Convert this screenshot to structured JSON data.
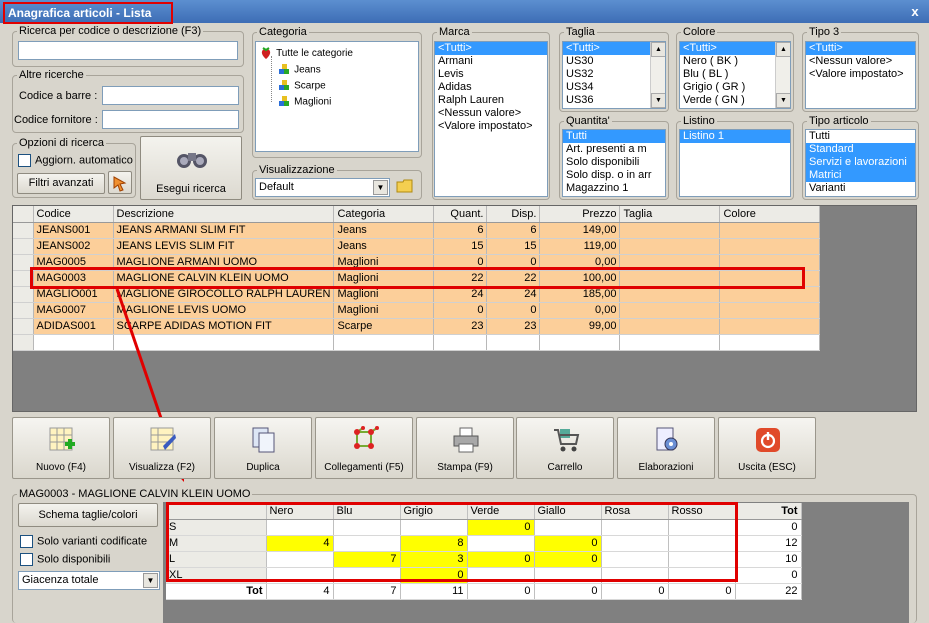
{
  "window": {
    "title": "Anagrafica articoli  - Lista",
    "close": "x"
  },
  "search": {
    "label": "Ricerca per codice o descrizione (F3)",
    "value": ""
  },
  "altre": {
    "label": "Altre ricerche",
    "barcode_label": "Codice a barre :",
    "barcode_value": "",
    "supplier_label": "Codice fornitore :",
    "supplier_value": ""
  },
  "opzioni": {
    "label": "Opzioni di ricerca",
    "auto_update": "Aggiorn. automatico",
    "advanced": "Filtri avanzati"
  },
  "execute": "Esegui ricerca",
  "categoria": {
    "label": "Categoria",
    "root": "Tutte le categorie",
    "children": [
      "Jeans",
      "Scarpe",
      "Maglioni"
    ]
  },
  "visualizzazione": {
    "label": "Visualizzazione",
    "value": "Default"
  },
  "marca": {
    "label": "Marca",
    "items": [
      "<Tutti>",
      "Armani",
      "Levis",
      "Adidas",
      "Ralph Lauren",
      "<Nessun valore>",
      "<Valore impostato>"
    ]
  },
  "taglia": {
    "label": "Taglia",
    "items": [
      "<Tutti>",
      "US30",
      "US32",
      "US34",
      "US36"
    ]
  },
  "colore": {
    "label": "Colore",
    "items": [
      "<Tutti>",
      "Nero ( BK )",
      "Blu ( BL )",
      "Grigio ( GR )",
      "Verde ( GN )"
    ]
  },
  "tipo3": {
    "label": "Tipo 3",
    "items": [
      "<Tutti>",
      "<Nessun valore>",
      "<Valore impostato>"
    ]
  },
  "quantita": {
    "label": "Quantita'",
    "items": [
      "Tutti",
      "Art. presenti a m",
      "Solo disponibili",
      "Solo disp. o in arr",
      "Magazzino 1"
    ]
  },
  "listino": {
    "label": "Listino",
    "items": [
      "Listino 1"
    ]
  },
  "tipo_articolo": {
    "label": "Tipo articolo",
    "items": [
      "Tutti",
      "Standard",
      "Servizi e lavorazioni",
      "Matrici",
      "Varianti"
    ]
  },
  "grid": {
    "columns": [
      "Codice",
      "Descrizione",
      "Categoria",
      "Quant.",
      "Disp.",
      "Prezzo",
      "Taglia",
      "Colore"
    ],
    "rows": [
      [
        "JEANS001",
        "JEANS ARMANI SLIM FIT",
        "Jeans",
        "6",
        "6",
        "149,00",
        "",
        ""
      ],
      [
        "JEANS002",
        "JEANS LEVIS SLIM  FIT",
        "Jeans",
        "15",
        "15",
        "119,00",
        "",
        ""
      ],
      [
        "MAG0005",
        "MAGLIONE ARMANI UOMO",
        "Maglioni",
        "0",
        "0",
        "0,00",
        "",
        ""
      ],
      [
        "MAG0003",
        "MAGLIONE CALVIN KLEIN UOMO",
        "Maglioni",
        "22",
        "22",
        "100,00",
        "",
        ""
      ],
      [
        "MAGLIO001",
        "MAGLIONE GIROCOLLO RALPH LAUREN",
        "Maglioni",
        "24",
        "24",
        "185,00",
        "",
        ""
      ],
      [
        "MAG0007",
        "MAGLIONE LEVIS UOMO",
        "Maglioni",
        "0",
        "0",
        "0,00",
        "",
        ""
      ],
      [
        "ADIDAS001",
        "SCARPE ADIDAS MOTION FIT",
        "Scarpe",
        "23",
        "23",
        "99,00",
        "",
        ""
      ]
    ]
  },
  "toolbar": [
    "Nuovo (F4)",
    "Visualizza (F2)",
    "Duplica",
    "Collegamenti (F5)",
    "Stampa (F9)",
    "Carrello",
    "Elaborazioni",
    "Uscita (ESC)"
  ],
  "detail": {
    "title": "MAG0003 - MAGLIONE CALVIN KLEIN UOMO",
    "scheme_button": "Schema taglie/colori",
    "only_coded": "Solo varianti codificate",
    "only_available": "Solo disponibili",
    "giacenza": "Giacenza totale",
    "colors": [
      "Nero",
      "Blu",
      "Grigio",
      "Verde",
      "Giallo",
      "Rosa",
      "Rosso"
    ],
    "tot_label": "Tot",
    "sizes": [
      {
        "size": "S",
        "cells": [
          "",
          "",
          "",
          "0",
          "",
          "",
          ""
        ],
        "tot": "0"
      },
      {
        "size": "M",
        "cells": [
          "4",
          "",
          "8",
          "",
          "0",
          "",
          ""
        ],
        "tot": "12"
      },
      {
        "size": "L",
        "cells": [
          "",
          "7",
          "3",
          "0",
          "0",
          "",
          ""
        ],
        "tot": "10"
      },
      {
        "size": "XL",
        "cells": [
          "",
          "",
          "0",
          "",
          "",
          "",
          ""
        ],
        "tot": "0"
      }
    ],
    "totals": [
      "4",
      "7",
      "11",
      "0",
      "0",
      "0",
      "0"
    ],
    "grand_total": "22"
  },
  "colors": {
    "title_bg": "#3d6db5",
    "row_bg": "#fccf9a",
    "selection": "#3399ff",
    "highlight": "#ffff00",
    "annotation": "#e00000"
  }
}
